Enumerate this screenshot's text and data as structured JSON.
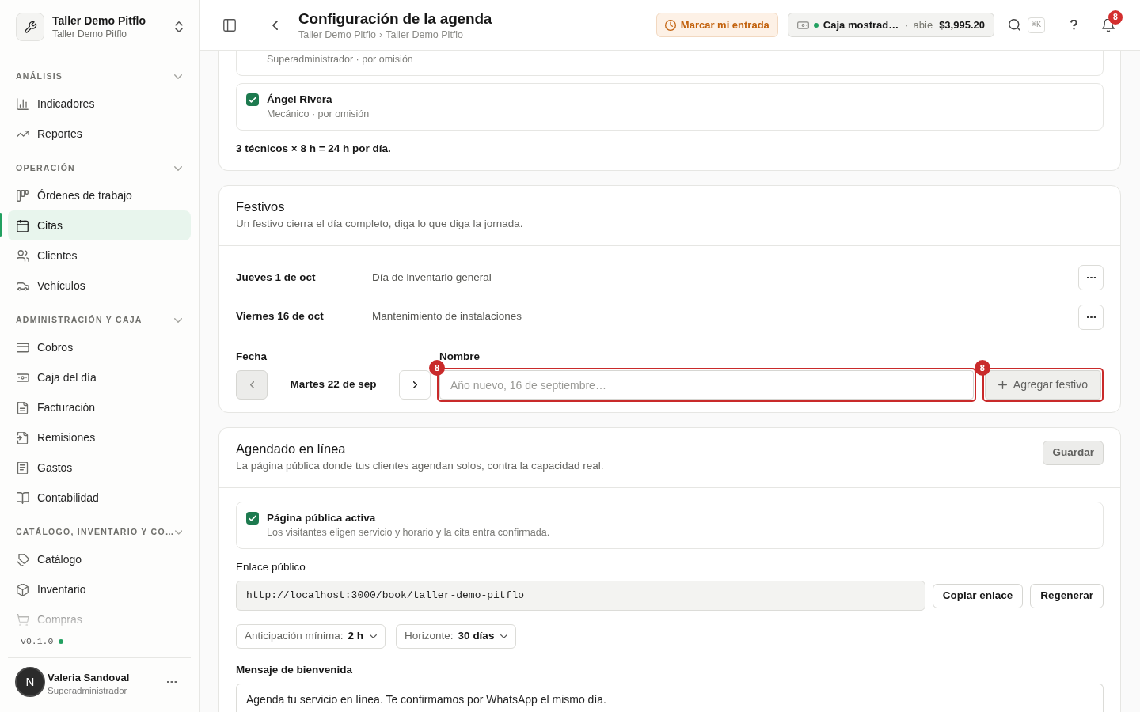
{
  "sidebar": {
    "workspace": {
      "name": "Taller Demo Pitflo",
      "subtitle": "Taller Demo Pitflo"
    },
    "sections": [
      {
        "title": "ANÁLISIS",
        "expanded": true,
        "items": [
          {
            "label": "Indicadores",
            "selected": false
          },
          {
            "label": "Reportes",
            "selected": false
          }
        ]
      },
      {
        "title": "OPERACIÓN",
        "expanded": true,
        "items": [
          {
            "label": "Órdenes de trabajo",
            "selected": false
          },
          {
            "label": "Citas",
            "selected": true
          },
          {
            "label": "Clientes",
            "selected": false
          },
          {
            "label": "Vehículos",
            "selected": false
          }
        ]
      },
      {
        "title": "ADMINISTRACIÓN Y CAJA",
        "expanded": true,
        "items": [
          {
            "label": "Cobros",
            "selected": false
          },
          {
            "label": "Caja del día",
            "selected": false
          },
          {
            "label": "Facturación",
            "selected": false
          },
          {
            "label": "Remisiones",
            "selected": false
          },
          {
            "label": "Gastos",
            "selected": false
          },
          {
            "label": "Contabilidad",
            "selected": false
          }
        ]
      },
      {
        "title": "CATÁLOGO, INVENTARIO Y CO…",
        "expanded": true,
        "items": [
          {
            "label": "Catálogo",
            "selected": false
          },
          {
            "label": "Inventario",
            "selected": false
          },
          {
            "label": "Compras",
            "selected": false
          }
        ]
      }
    ],
    "version": "v0.1.0",
    "user": {
      "initial": "N",
      "name": "Valeria Sandoval",
      "role": "Superadministrador"
    }
  },
  "header": {
    "title": "Configuración de la agenda",
    "breadcrumb": [
      "Taller Demo Pitflo",
      "Taller Demo Pitflo"
    ],
    "breadcrumb_separator": "›",
    "clock_in_button": "Marcar mi entrada",
    "cash_register": {
      "name": "Caja mostrad…",
      "separator": "·",
      "status": "abie",
      "amount": "$3,995.20"
    },
    "search_shortcut": "⌘K",
    "notifications_count": "8"
  },
  "technicians_card": {
    "members": [
      {
        "kind": "partial",
        "detail": "Superadministrador · por omisión"
      },
      {
        "kind": "full",
        "name": "Ángel Rivera",
        "detail": "Mecánico · por omisión",
        "checked": true
      }
    ],
    "summary": "3 técnicos × 8 h = 24 h por día."
  },
  "holidays": {
    "title": "Festivos",
    "subtitle": "Un festivo cierra el día completo, diga lo que diga la jornada.",
    "rows": [
      {
        "date": "Jueves 1 de oct",
        "name": "Día de inventario general"
      },
      {
        "date": "Viernes 16 de oct",
        "name": "Mantenimiento de instalaciones"
      }
    ],
    "form": {
      "date_picker": {
        "label": "Fecha",
        "value": "Martes 22 de sep",
        "previous": {
          "disabled": true
        },
        "next": {
          "disabled": false
        }
      },
      "name_field": {
        "label": "Nombre",
        "placeholder": "Año nuevo, 16 de septiembre…",
        "issue_count": "8"
      },
      "add_button": {
        "label": "Agregar festivo",
        "disabled": true,
        "issue_count": "8"
      }
    }
  },
  "online_booking": {
    "title": "Agendado en línea",
    "subtitle": "La página pública donde tus clientes agendan solos, contra la capacidad real.",
    "save_button": {
      "label": "Guardar",
      "disabled": true
    },
    "public_page": {
      "label": "Página pública activa",
      "description": "Los visitantes eligen servicio y horario y la cita entra confirmada.",
      "checked": true
    },
    "link": {
      "label": "Enlace público",
      "value": "http://localhost:3000/book/taller-demo-pitflo",
      "buttons": [
        "Copiar enlace",
        "Regenerar"
      ]
    },
    "selects": [
      {
        "label": "Anticipación mínima:",
        "value": "2 h"
      },
      {
        "label": "Horizonte:",
        "value": "30 días"
      }
    ],
    "welcome": {
      "label": "Mensaje de bienvenida",
      "value": "Agenda tu servicio en línea. Te confirmamos por WhatsApp el mismo día."
    }
  }
}
